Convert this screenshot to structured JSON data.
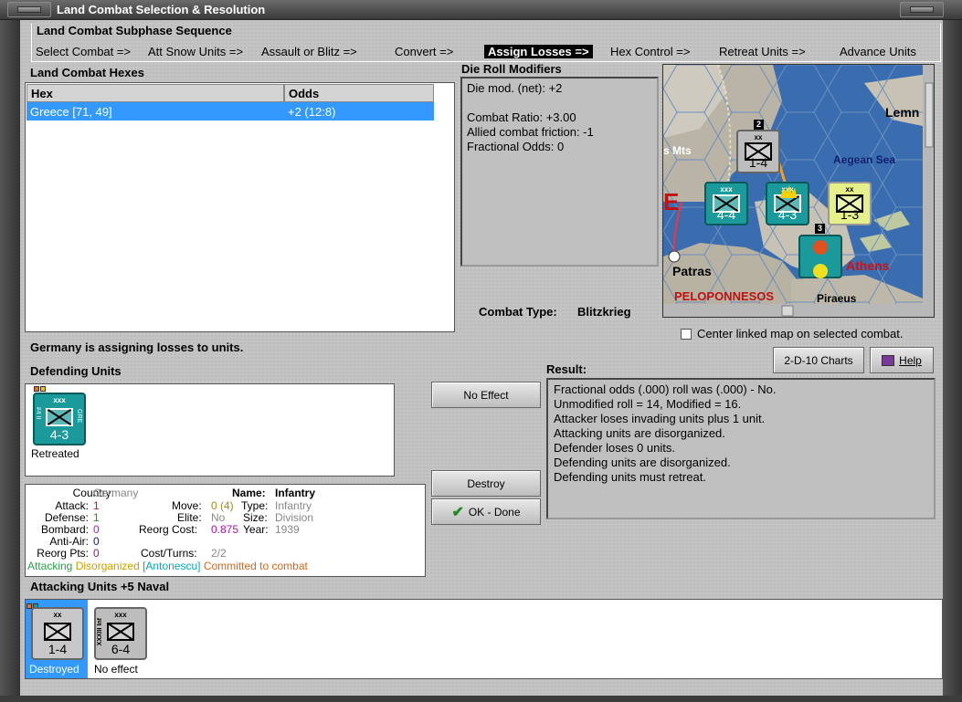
{
  "window": {
    "title": "Land Combat Selection & Resolution"
  },
  "sequence": {
    "title": "Land Combat Subphase Sequence",
    "steps": [
      "Select Combat =>",
      "Att Snow Units =>",
      "Assault or Blitz =>",
      "Convert =>",
      "Assign Losses =>",
      "Hex Control =>",
      "Retreat Units =>",
      "Advance Units"
    ],
    "active_index": 4
  },
  "hexes": {
    "title": "Land Combat Hexes",
    "columns": [
      "Hex",
      "Odds"
    ],
    "rows": [
      {
        "hex": "Greece [71, 49]",
        "odds": "+2 (12:8)"
      }
    ]
  },
  "modifiers": {
    "title": "Die Roll Modifiers",
    "lines": [
      "Die mod. (net): +2",
      "",
      "Combat Ratio: +3.00",
      "Allied combat friction: -1",
      "Fractional Odds: 0"
    ]
  },
  "combat_type": {
    "label": "Combat Type:",
    "value": "Blitzkrieg"
  },
  "map": {
    "labels": [
      "Lemn",
      "Aegean Sea",
      "s Mts",
      "Patras",
      "Athens",
      "PELOPONNESOS",
      "Piraeus",
      "E"
    ],
    "units": [
      {
        "size": "xx",
        "value": "1-4"
      },
      {
        "size": "xxx",
        "value": "4-4"
      },
      {
        "size": "xxx",
        "value": "4-3"
      },
      {
        "size": "xx",
        "value": "1-3"
      }
    ],
    "stack_counts": [
      "2",
      "3"
    ],
    "center_checkbox_label": "Center linked map on selected combat."
  },
  "status_message": "Germany is assigning losses to units.",
  "defending": {
    "title": "Defending Units",
    "units": [
      {
        "size": "xxx",
        "value": "4-3",
        "side": "GRE",
        "corps": "II Inf",
        "status": "Retreated"
      }
    ]
  },
  "buttons": {
    "no_effect": "No Effect",
    "destroy": "Destroy",
    "ok_done": "OK - Done",
    "charts": "2-D-10 Charts",
    "help": "Help"
  },
  "result": {
    "title": "Result:",
    "lines": [
      "Fractional odds (.000) roll was (.000)  - No.",
      "Unmodified roll = 14, Modified = 16.",
      "Attacker loses invading units plus 1 unit.",
      "Attacking units are disorganized.",
      "Defender loses 0 units.",
      "Defending units are disorganized.",
      "Defending units must retreat."
    ]
  },
  "unit_info": {
    "country_label": "Country:",
    "country": "Germany",
    "attack_label": "Attack:",
    "attack": "1",
    "defense_label": "Defense:",
    "defense": "1",
    "bombard_label": "Bombard:",
    "bombard": "0",
    "antiair_label": "Anti-Air:",
    "antiair": "0",
    "reorgpts_label": "Reorg Pts:",
    "reorgpts": "0",
    "name_label": "Name:",
    "name": "Infantry",
    "move_label": "Move:",
    "move": "0 (4)",
    "type_label": "Type:",
    "type": "Infantry",
    "elite_label": "Elite:",
    "elite": "No",
    "size_label": "Size:",
    "size": "Division",
    "reorgcost_label": "Reorg Cost:",
    "reorgcost": "0.875",
    "year_label": "Year:",
    "year": "1939",
    "costturns_label": "Cost/Turns:",
    "costturns": "2/2",
    "status_attacking": "Attacking",
    "status_disorganized": "Disorganized",
    "status_antonescu": "[Antonescu]",
    "status_committed": "Committed to combat"
  },
  "attacking": {
    "title": "Attacking Units +5 Naval",
    "units": [
      {
        "size": "xx",
        "value": "1-4",
        "status": "Destroyed"
      },
      {
        "size": "xxx",
        "value": "6-4",
        "corps": "XXXIII Inf",
        "status": "No effect"
      }
    ]
  },
  "colors": {
    "selection": "#3399ff",
    "teal_unit": "#1a9a9a",
    "grey_unit": "#bdbdbd",
    "yellow_unit": "#e6f08a",
    "attacking_green": "#2aa04a",
    "disorganized_yellow": "#c8a000",
    "antonescu_cyan": "#0aa6b0",
    "committed_orange": "#d2691e"
  }
}
